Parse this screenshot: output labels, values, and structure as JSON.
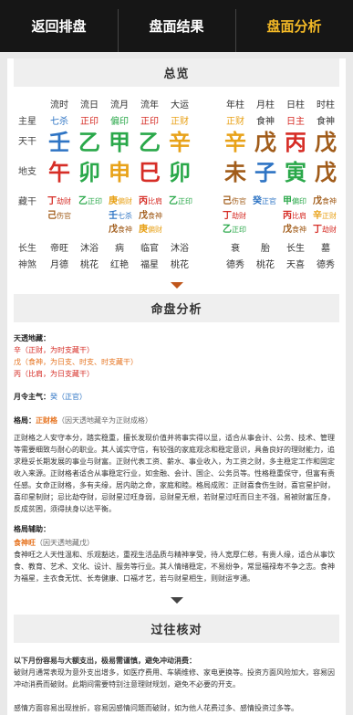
{
  "tabs": [
    {
      "label": "返回排盘"
    },
    {
      "label": "盘面结果"
    },
    {
      "label": "盘面分析"
    }
  ],
  "sections": {
    "overview": "总览",
    "analysis": "命盘分析",
    "fortune": "过往核对"
  },
  "row_labels": [
    "主星",
    "天干",
    "地支",
    "藏干",
    "长生",
    "神煞"
  ],
  "columns_left": [
    "流时",
    "流日",
    "流月",
    "流年",
    "大运"
  ],
  "columns_right": [
    "年柱",
    "月柱",
    "日柱",
    "时柱"
  ],
  "zhuxing_left": [
    "七杀",
    "正印",
    "偏印",
    "正印",
    "正财"
  ],
  "zhuxing_right": [
    "正财",
    "食神",
    "日主",
    "食神"
  ],
  "tiangan_left": [
    "壬",
    "乙",
    "甲",
    "乙",
    "辛"
  ],
  "tiangan_right": [
    "辛",
    "戊",
    "丙",
    "戊"
  ],
  "dizhi_left": [
    "午",
    "卯",
    "申",
    "巳",
    "卯"
  ],
  "dizhi_right": [
    "未",
    "子",
    "寅",
    "戊"
  ],
  "canggan_left": [
    [
      {
        "g": "丁",
        "s": "劫财"
      },
      {
        "g": "己",
        "s": "伤官"
      }
    ],
    [
      {
        "g": "乙",
        "s": "正印"
      }
    ],
    [
      {
        "g": "庚",
        "s": "偏财"
      },
      {
        "g": "壬",
        "s": "七杀"
      },
      {
        "g": "戊",
        "s": "食神"
      }
    ],
    [
      {
        "g": "丙",
        "s": "比肩"
      },
      {
        "g": "戊",
        "s": "食神"
      },
      {
        "g": "庚",
        "s": "偏财"
      }
    ],
    [
      {
        "g": "乙",
        "s": "正印"
      }
    ]
  ],
  "canggan_right": [
    [
      {
        "g": "己",
        "s": "伤官"
      },
      {
        "g": "丁",
        "s": "劫财"
      },
      {
        "g": "乙",
        "s": "正印"
      }
    ],
    [
      {
        "g": "癸",
        "s": "正官"
      }
    ],
    [
      {
        "g": "甲",
        "s": "偏印"
      },
      {
        "g": "丙",
        "s": "比肩"
      },
      {
        "g": "戊",
        "s": "食神"
      }
    ],
    [
      {
        "g": "戊",
        "s": "食神"
      },
      {
        "g": "辛",
        "s": "正财"
      },
      {
        "g": "丁",
        "s": "劫财"
      }
    ]
  ],
  "changsheng_left": [
    "帝旺",
    "沐浴",
    "病",
    "临官",
    "沐浴"
  ],
  "changsheng_right": [
    "衰",
    "胎",
    "长生",
    "墓"
  ],
  "shensha_left": [
    "月德",
    "桃花",
    "红艳",
    "福星",
    "桃花"
  ],
  "shensha_right": [
    "德秀",
    "桃花",
    "天喜",
    "德秀"
  ],
  "analysis": {
    "tianyuan_title": "天透地藏：",
    "tianyuan_lines": [
      "辛（正财，为时支藏干）",
      "戊（食神，为日支、时支、时支藏干）",
      "丙（比肩，为日支藏干）"
    ],
    "yueling_label": "月令主气：",
    "yueling_value": "癸（正官）",
    "geju_label": "格局：",
    "geju_value": "正财格",
    "geju_note": "（因天透地藏辛为正财成格）",
    "geju_text": "正财格之人安守本分，踏实稳重，擅长发现价值并将事实得以显，适合从事会计、公务、技术、管理等需要细致与耐心的职业。其人诚实守信，有较强的家庭观念和稳定意识，具备良好的理财能力，追求稳妥长期发展的事业与财富。正财代表工资、薪水、事业收入，为工资之财，多主稳定工作和固定收入来源。正财格者适合从事稳定行业，如金融、会计、国企、公务员等。性格稳重保守，但富有责任感。女命正财格，多有夫缘，居内助之命，家庭和睦。格局成败：正财喜食伤生财，喜官星护财，喜印星制财；忌比劫夺财，忌财星过旺身弱，忌财星无根，若财星过旺而日主不强，易被财富压身，反成贫困，须得扶身以达平衡。",
    "huzhu_label": "格局辅助：",
    "huzhu_value": "食神旺",
    "huzhu_note": "（因天透地藏戊）",
    "huzhu_text": "食神旺之人天性温和、乐观豁达，重视生活品质与精神享受，待人宽厚仁慈，有贵人缘，适合从事饮食、教育、艺术、文化、设计、服务等行业。其人情绪稳定，不易纷争，常显福禄寿不争之志。食神为福星，主衣食无忧、长寿健康、口福才艺，若与财星相生，则财运亨通。"
  },
  "fortune": {
    "lead": "以下月份容易与大额支出，极易需谨慎，避免冲动消费：",
    "para1": "破财月通常表现为意外支出增多，如医疗费用、车辆维修、家电更换等。投资方面风险加大，容易因冲动消费而破财。此期间需要特别注意理财规划，避免不必要的开支。",
    "para2": "感情方面容易出现挫折，容易因感情问题而破财，如为他人花费过多、感情投资过多等。"
  }
}
